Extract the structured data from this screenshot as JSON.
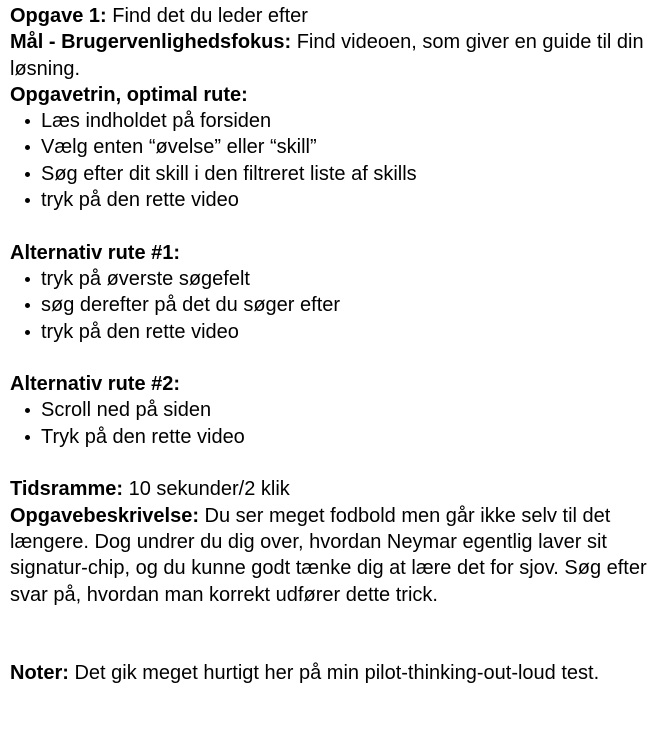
{
  "task": {
    "title_label": "Opgave 1:",
    "title_text": " Find det du leder efter",
    "goal_label": "Mål - Brugervenlighedsfokus:",
    "goal_text": " Find videoen, som giver en guide til din løsning."
  },
  "optimal_route": {
    "heading": "Opgavetrin, optimal rute:",
    "steps": [
      "Læs indholdet på forsiden",
      "Vælg enten “øvelse” eller “skill”",
      "Søg efter dit skill i den filtreret liste af skills",
      "tryk på den rette video"
    ]
  },
  "alt_route_1": {
    "heading": "Alternativ rute #1:",
    "steps": [
      "tryk på øverste søgefelt",
      "søg derefter på det du søger efter",
      "tryk på den rette video"
    ]
  },
  "alt_route_2": {
    "heading": "Alternativ rute #2:",
    "steps": [
      "Scroll ned på siden",
      "Tryk på den rette video"
    ]
  },
  "timeframe": {
    "label": "Tidsramme:",
    "text": " 10 sekunder/2 klik"
  },
  "description": {
    "label": "Opgavebeskrivelse:",
    "text": " Du ser meget fodbold men går ikke selv til det længere. Dog undrer du dig over, hvordan Neymar egentlig laver sit signatur-chip, og du kunne godt tænke dig at lære det for sjov. Søg efter svar på, hvordan man korrekt udfører dette trick."
  },
  "notes": {
    "label": "Noter:",
    "text": " Det gik meget hurtigt her på min pilot-thinking-out-loud test."
  }
}
